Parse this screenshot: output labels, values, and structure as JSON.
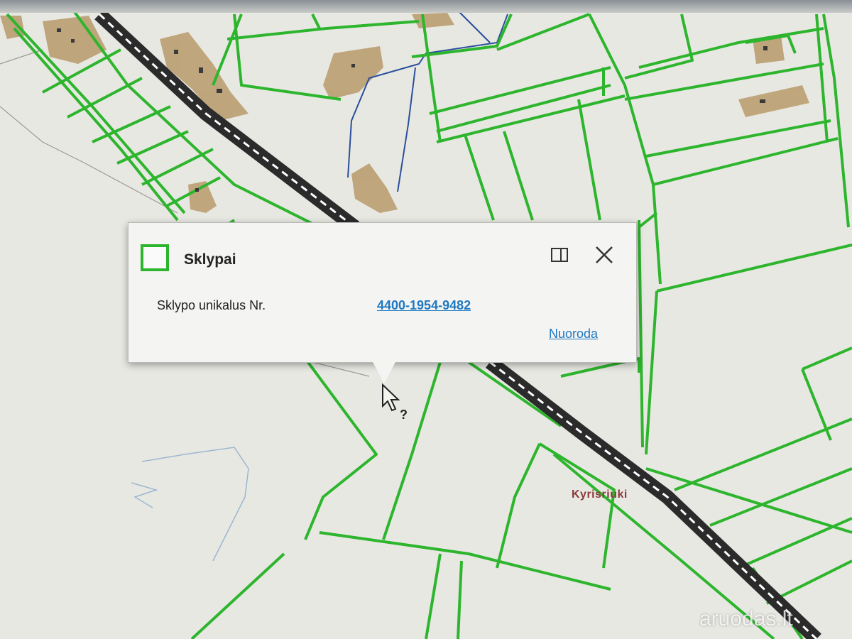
{
  "colors": {
    "parcel_border": "#2db52d",
    "map_background": "#e8e8e3",
    "railway": "#2b2b2b",
    "water": "#2a4f9c",
    "building_area": "#b89a6a",
    "link": "#1f78c1"
  },
  "map": {
    "place_label": "Kyrisriuki"
  },
  "popup": {
    "title": "Sklypai",
    "layer_icon": "square-swatch-icon",
    "maximize_icon": "maximize-icon",
    "close_icon": "close-icon",
    "field_label": "Sklypo unikalus Nr.",
    "field_value": "4400-1954-9482",
    "link_label": "Nuoroda"
  },
  "cursor": {
    "icon": "help-cursor-icon"
  },
  "watermark": "aruodas.lt"
}
